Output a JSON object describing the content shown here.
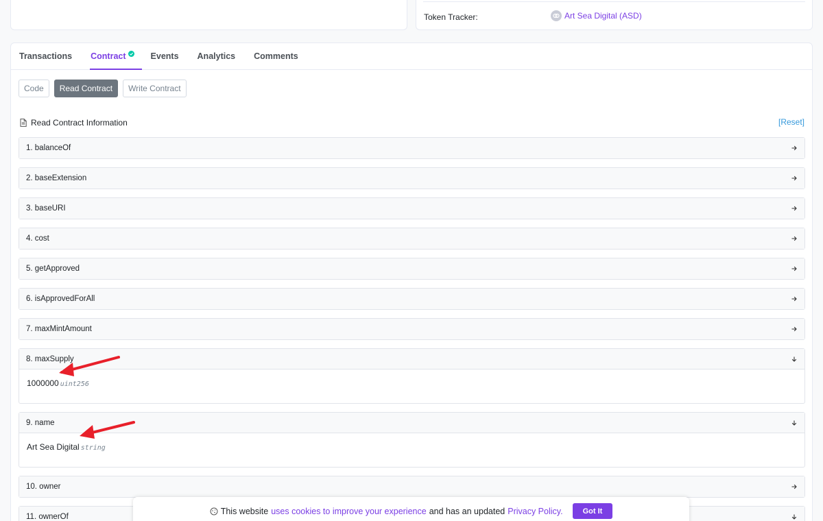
{
  "token_tracker": {
    "label": "Token Tracker:",
    "value": "Art Sea Digital (ASD)"
  },
  "tabs": [
    {
      "label": "Transactions",
      "active": false
    },
    {
      "label": "Contract",
      "active": true,
      "verified": true
    },
    {
      "label": "Events",
      "active": false
    },
    {
      "label": "Analytics",
      "active": false
    },
    {
      "label": "Comments",
      "active": false
    }
  ],
  "subtabs": [
    {
      "label": "Code",
      "active": false
    },
    {
      "label": "Read Contract",
      "active": true
    },
    {
      "label": "Write Contract",
      "active": false
    }
  ],
  "read_contract": {
    "title": "Read Contract Information",
    "reset_label": "[Reset]",
    "functions": [
      {
        "label": "1. balanceOf",
        "open": false
      },
      {
        "label": "2. baseExtension",
        "open": false
      },
      {
        "label": "3. baseURI",
        "open": false
      },
      {
        "label": "4. cost",
        "open": false
      },
      {
        "label": "5. getApproved",
        "open": false
      },
      {
        "label": "6. isApprovedForAll",
        "open": false
      },
      {
        "label": "7. maxMintAmount",
        "open": false
      },
      {
        "label": "8. maxSupply",
        "open": true,
        "result_value": "1000000",
        "result_type": "uint256"
      },
      {
        "label": "9. name",
        "open": true,
        "result_value": "Art Sea Digital",
        "result_type": "string"
      },
      {
        "label": "10. owner",
        "open": false
      },
      {
        "label": "11. ownerOf",
        "open": true
      }
    ]
  },
  "cookie_banner": {
    "text_before": "This website",
    "link1": "uses cookies to improve your experience",
    "text_middle": "and has an updated",
    "link2": "Privacy Policy.",
    "button_label": "Got It"
  },
  "colors": {
    "accent": "#7b3fe4",
    "verified": "#00c9a7",
    "link": "#3498db",
    "annotation_arrow": "#e8202a"
  }
}
